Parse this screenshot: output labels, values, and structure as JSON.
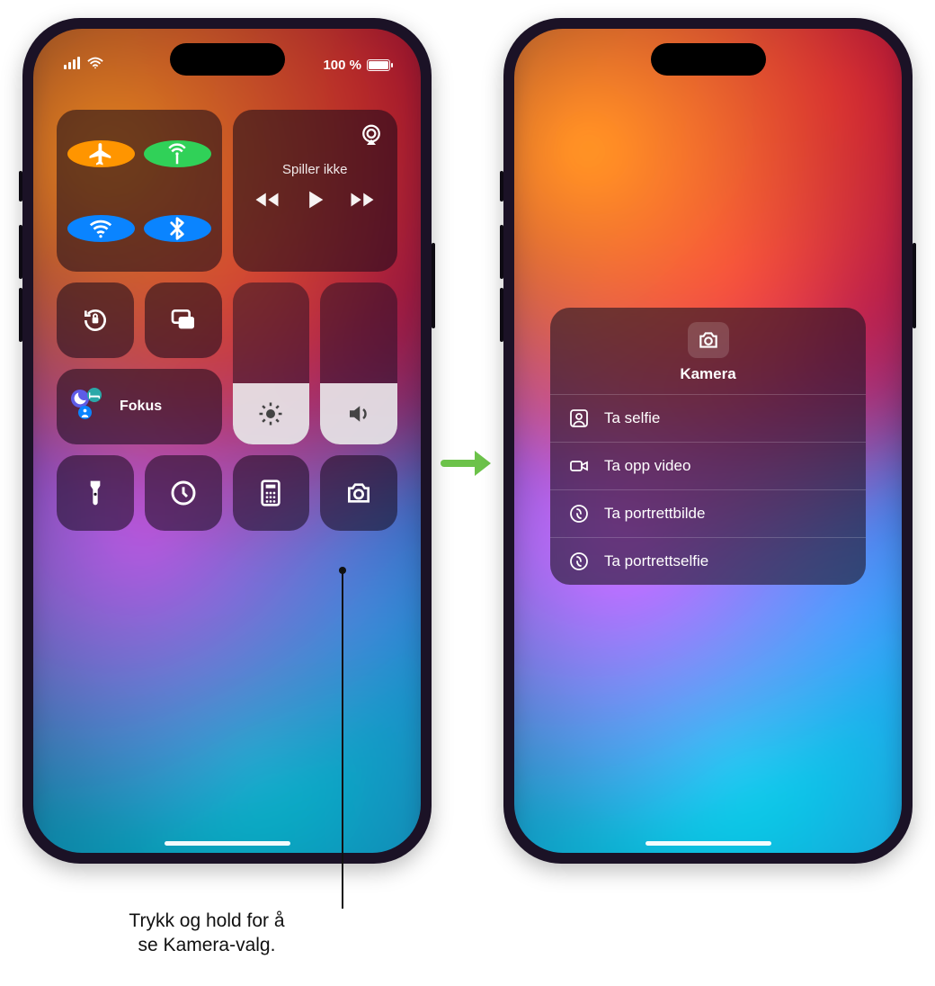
{
  "status": {
    "battery_text": "100 %"
  },
  "control_center": {
    "media": {
      "now_playing_label": "Spiller ikke"
    },
    "focus": {
      "label": "Fokus"
    },
    "brightness": {
      "height_pct": 38
    },
    "volume": {
      "height_pct": 38
    },
    "icon_names": {
      "airplane": "airplane-icon",
      "cellular": "cellular-antenna-icon",
      "wifi": "wifi-icon",
      "bluetooth": "bluetooth-icon",
      "rotation_lock": "rotation-lock-icon",
      "screen_mirroring": "screen-mirroring-icon",
      "flashlight": "flashlight-icon",
      "timer": "timer-icon",
      "calculator": "calculator-icon",
      "camera": "camera-icon"
    }
  },
  "camera_menu": {
    "title": "Kamera",
    "items": [
      {
        "label": "Ta selfie",
        "icon": "person-square-icon"
      },
      {
        "label": "Ta opp video",
        "icon": "video-camera-icon"
      },
      {
        "label": "Ta portrettbilde",
        "icon": "aperture-icon"
      },
      {
        "label": "Ta portrettselfie",
        "icon": "aperture-icon"
      }
    ]
  },
  "callout": {
    "line1": "Trykk og hold for å",
    "line2": "se Kamera-valg."
  }
}
